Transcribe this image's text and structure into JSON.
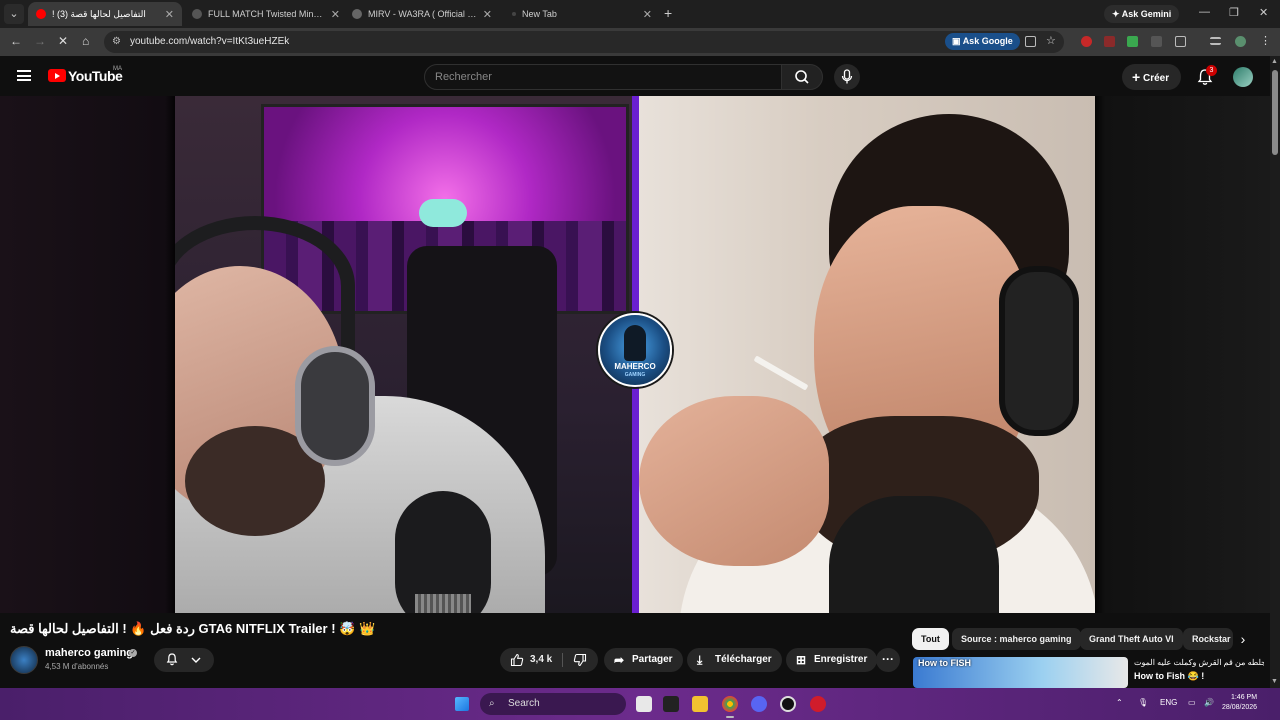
{
  "browser": {
    "tabs": [
      {
        "label": "! التفاصيل لحالها قصة (3)",
        "active": true
      },
      {
        "label": "FULL MATCH Twisted Minds vs",
        "active": false
      },
      {
        "label": "MIRV - WA3RA ( Official music",
        "active": false
      },
      {
        "label": "New Tab",
        "active": false
      }
    ],
    "ask_gemini": "Ask Gemini",
    "url": "youtube.com/watch?v=ItKt3ueHZEk",
    "ask_google": "Ask Google"
  },
  "youtube": {
    "logo_text": "YouTube",
    "region": "MA",
    "search_placeholder": "Rechercher",
    "create_label": "Créer",
    "notification_count": "3"
  },
  "video": {
    "channel_logo_text": "MAHERCO",
    "channel_logo_sub": "GAMING"
  },
  "watch": {
    "title": "ردة فعل 🔥 ! التفاصيل لحالها قصة GTA6 NITFLIX Trailer ! 🤯 👑",
    "channel_name": "maherco gaming",
    "verified_mark": "✓",
    "subscribers": "4,53 M d'abonnés",
    "like_count": "3,4 k",
    "share_label": "Partager",
    "download_label": "Télécharger",
    "save_label": "Enregistrer",
    "more_label": "···"
  },
  "chips": [
    "Tout",
    "Source : maherco gaming",
    "Grand Theft Auto VI",
    "Rockstar"
  ],
  "recommendation": {
    "thumb_text": "How to FISH",
    "title_line1": "طلعت جلطه من قم القرش وكملت عليه الموت !",
    "title_line2": "How to Fish 😂 !"
  },
  "taskbar": {
    "search_label": "Search",
    "language": "ENG",
    "time": "1:46 PM",
    "date": "28/08/2026"
  },
  "colors": {
    "youtube_red": "#ff0000",
    "divider_purple": "#6a1fd1",
    "taskbar_purple": "#6c2b8c"
  }
}
